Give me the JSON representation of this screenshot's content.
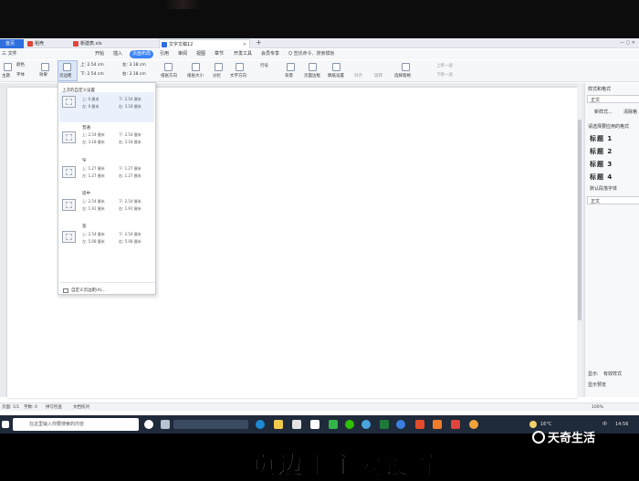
{
  "colors": {
    "accent": "#3a82f7",
    "taskbar": "#1f2a3a",
    "caption": "#ffffff"
  },
  "tabs": {
    "home": "首页",
    "t1": "稻壳",
    "t2": "新建表.xls",
    "doc": "文字文稿12"
  },
  "menu": {
    "file": "三 文件",
    "start": "开始",
    "insert": "插入",
    "page_layout": "页面布局",
    "reference": "引用",
    "review": "审阅",
    "view": "视图",
    "chapter": "章节",
    "dev": "开发工具",
    "member": "会员专享",
    "search": "Q 查找命令、搜索模板"
  },
  "ribbon": {
    "theme": "主题",
    "color": "颜色",
    "font": "字体",
    "effect": "效果",
    "margin_label": "页边距",
    "up_val": "上: 2.54 cm",
    "down_val": "下: 2.54 cm",
    "left_val": "左: 3.18 cm",
    "right_val": "右: 3.18 cm",
    "orientation": "纸张方向",
    "size": "纸张大小",
    "columns": "分栏",
    "text_dir": "文字方向",
    "line_num": "行号",
    "bg": "背景",
    "page_border": "页面边框",
    "watermark": "稿纸设置",
    "align": "对齐",
    "rotate": "旋转",
    "select_pane": "选择窗格",
    "up_layer": "上移一层",
    "down_layer": "下移一层"
  },
  "dropdown": {
    "recent_title": "上次的自定义设置",
    "recent_a": "上: 0 厘米",
    "recent_b": "下: 2.54 厘米",
    "recent_c": "左: 0 厘米",
    "recent_d": "右: 3.18 厘米",
    "normal_title": "普通",
    "normal_a": "上: 2.54 厘米",
    "normal_b": "下: 2.54 厘米",
    "normal_c": "左: 3.18 厘米",
    "normal_d": "右: 3.18 厘米",
    "narrow_title": "窄",
    "narrow_a": "上: 1.27 厘米",
    "narrow_b": "下: 1.27 厘米",
    "narrow_c": "左: 1.27 厘米",
    "narrow_d": "右: 1.27 厘米",
    "moderate_title": "适中",
    "moderate_a": "上: 2.54 厘米",
    "moderate_b": "下: 2.54 厘米",
    "moderate_c": "左: 1.91 厘米",
    "moderate_d": "右: 1.91 厘米",
    "wide_title": "宽",
    "wide_a": "上: 2.54 厘米",
    "wide_b": "下: 2.54 厘米",
    "wide_c": "左: 5.08 厘米",
    "wide_d": "右: 5.08 厘米",
    "custom": "自定义页边距(A)..."
  },
  "right_panel": {
    "title": "样式和格式",
    "current": "正文",
    "btn_new": "新样式...",
    "btn_clear": "清除格",
    "pick_label": "请选择要应用的格式",
    "h1": "标题 1",
    "h2": "标题 2",
    "h3": "标题 3",
    "h4": "标题 4",
    "default_label": "默认段落字体",
    "body": "正文",
    "show_label": "显示:",
    "show_val": "有效样式",
    "preview": "显示预览"
  },
  "status": {
    "page": "页面: 1/1",
    "words": "字数: 0",
    "spell": "拼写检查",
    "doc_check": "文档校对",
    "zoom": "100%"
  },
  "taskbar": {
    "search_placeholder": "在这里输入你要搜索的内容",
    "temp": "16°C",
    "ime": "中",
    "time": "14:56"
  },
  "caption": "页边距主要设置",
  "logo": "天奇生活"
}
